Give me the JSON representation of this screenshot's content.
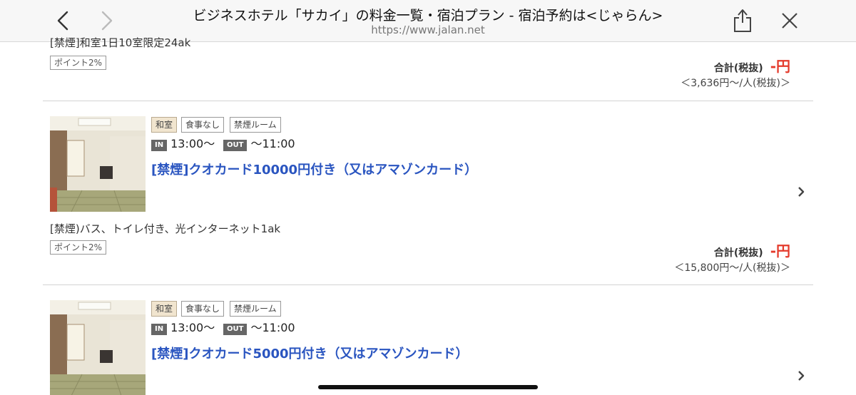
{
  "browser": {
    "title": "ビジネスホテル「サカイ」の料金一覧・宿泊プラン - 宿泊予約は<じゃらん>",
    "url": "https://www.jalan.net"
  },
  "plan0": {
    "description": "[禁煙]和室1日10室限定24ak",
    "points": "ポイント2%",
    "total_label": "合計(税抜)",
    "total_price": "-円",
    "per_person": "＜3,636円～/人(税抜)＞"
  },
  "plan1": {
    "tags": [
      "和室",
      "食事なし",
      "禁煙ルーム"
    ],
    "in_label": "IN",
    "in_time": "13:00～",
    "out_label": "OUT",
    "out_time": "～11:00",
    "title": "[禁煙]クオカード10000円付き（又はアマゾンカード）",
    "description": "[禁煙)バス、トイレ付き、光インターネット1ak",
    "points": "ポイント2%",
    "total_label": "合計(税抜)",
    "total_price": "-円",
    "per_person": "＜15,800円～/人(税抜)＞"
  },
  "plan2": {
    "tags": [
      "和室",
      "食事なし",
      "禁煙ルーム"
    ],
    "in_label": "IN",
    "in_time": "13:00～",
    "out_label": "OUT",
    "out_time": "～11:00",
    "title": "[禁煙]クオカード5000円付き（又はアマゾンカード）"
  },
  "icons": {
    "back": "chevron-left-icon",
    "forward": "chevron-right-icon",
    "share": "share-icon",
    "close": "close-icon",
    "row_arrow": "chevron-right-icon"
  },
  "colors": {
    "link": "#2a55c0",
    "price": "#e43b2c",
    "tag_washitsu_bg": "#f1e5cf"
  }
}
